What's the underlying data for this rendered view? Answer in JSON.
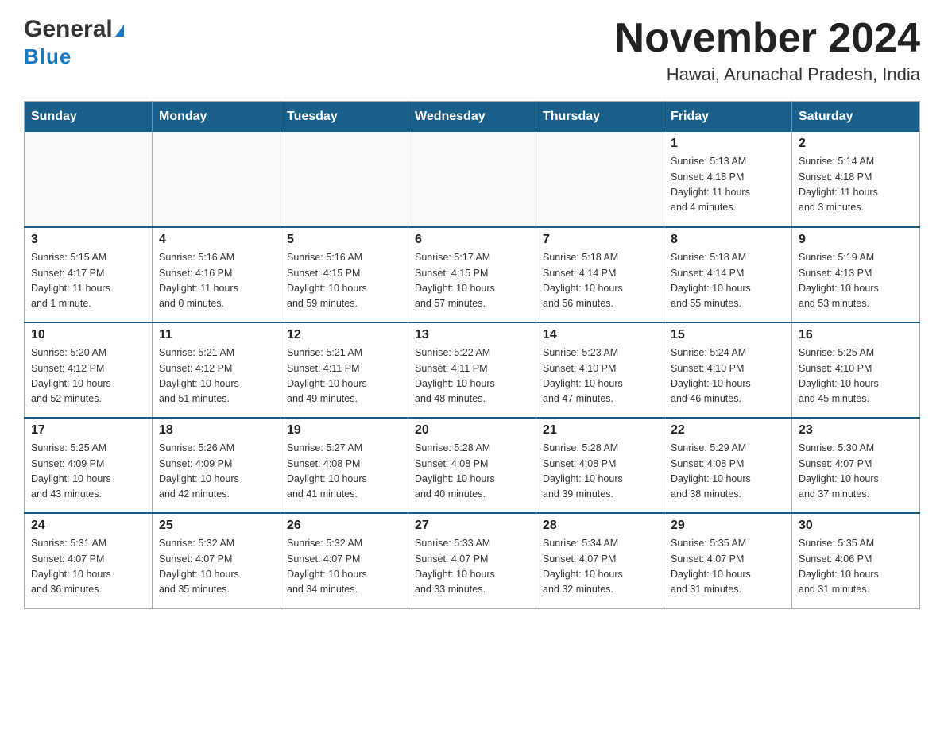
{
  "header": {
    "logo_general": "General",
    "logo_blue": "Blue",
    "month_title": "November 2024",
    "location": "Hawai, Arunachal Pradesh, India"
  },
  "weekdays": [
    "Sunday",
    "Monday",
    "Tuesday",
    "Wednesday",
    "Thursday",
    "Friday",
    "Saturday"
  ],
  "weeks": [
    [
      {
        "day": "",
        "info": ""
      },
      {
        "day": "",
        "info": ""
      },
      {
        "day": "",
        "info": ""
      },
      {
        "day": "",
        "info": ""
      },
      {
        "day": "",
        "info": ""
      },
      {
        "day": "1",
        "info": "Sunrise: 5:13 AM\nSunset: 4:18 PM\nDaylight: 11 hours\nand 4 minutes."
      },
      {
        "day": "2",
        "info": "Sunrise: 5:14 AM\nSunset: 4:18 PM\nDaylight: 11 hours\nand 3 minutes."
      }
    ],
    [
      {
        "day": "3",
        "info": "Sunrise: 5:15 AM\nSunset: 4:17 PM\nDaylight: 11 hours\nand 1 minute."
      },
      {
        "day": "4",
        "info": "Sunrise: 5:16 AM\nSunset: 4:16 PM\nDaylight: 11 hours\nand 0 minutes."
      },
      {
        "day": "5",
        "info": "Sunrise: 5:16 AM\nSunset: 4:15 PM\nDaylight: 10 hours\nand 59 minutes."
      },
      {
        "day": "6",
        "info": "Sunrise: 5:17 AM\nSunset: 4:15 PM\nDaylight: 10 hours\nand 57 minutes."
      },
      {
        "day": "7",
        "info": "Sunrise: 5:18 AM\nSunset: 4:14 PM\nDaylight: 10 hours\nand 56 minutes."
      },
      {
        "day": "8",
        "info": "Sunrise: 5:18 AM\nSunset: 4:14 PM\nDaylight: 10 hours\nand 55 minutes."
      },
      {
        "day": "9",
        "info": "Sunrise: 5:19 AM\nSunset: 4:13 PM\nDaylight: 10 hours\nand 53 minutes."
      }
    ],
    [
      {
        "day": "10",
        "info": "Sunrise: 5:20 AM\nSunset: 4:12 PM\nDaylight: 10 hours\nand 52 minutes."
      },
      {
        "day": "11",
        "info": "Sunrise: 5:21 AM\nSunset: 4:12 PM\nDaylight: 10 hours\nand 51 minutes."
      },
      {
        "day": "12",
        "info": "Sunrise: 5:21 AM\nSunset: 4:11 PM\nDaylight: 10 hours\nand 49 minutes."
      },
      {
        "day": "13",
        "info": "Sunrise: 5:22 AM\nSunset: 4:11 PM\nDaylight: 10 hours\nand 48 minutes."
      },
      {
        "day": "14",
        "info": "Sunrise: 5:23 AM\nSunset: 4:10 PM\nDaylight: 10 hours\nand 47 minutes."
      },
      {
        "day": "15",
        "info": "Sunrise: 5:24 AM\nSunset: 4:10 PM\nDaylight: 10 hours\nand 46 minutes."
      },
      {
        "day": "16",
        "info": "Sunrise: 5:25 AM\nSunset: 4:10 PM\nDaylight: 10 hours\nand 45 minutes."
      }
    ],
    [
      {
        "day": "17",
        "info": "Sunrise: 5:25 AM\nSunset: 4:09 PM\nDaylight: 10 hours\nand 43 minutes."
      },
      {
        "day": "18",
        "info": "Sunrise: 5:26 AM\nSunset: 4:09 PM\nDaylight: 10 hours\nand 42 minutes."
      },
      {
        "day": "19",
        "info": "Sunrise: 5:27 AM\nSunset: 4:08 PM\nDaylight: 10 hours\nand 41 minutes."
      },
      {
        "day": "20",
        "info": "Sunrise: 5:28 AM\nSunset: 4:08 PM\nDaylight: 10 hours\nand 40 minutes."
      },
      {
        "day": "21",
        "info": "Sunrise: 5:28 AM\nSunset: 4:08 PM\nDaylight: 10 hours\nand 39 minutes."
      },
      {
        "day": "22",
        "info": "Sunrise: 5:29 AM\nSunset: 4:08 PM\nDaylight: 10 hours\nand 38 minutes."
      },
      {
        "day": "23",
        "info": "Sunrise: 5:30 AM\nSunset: 4:07 PM\nDaylight: 10 hours\nand 37 minutes."
      }
    ],
    [
      {
        "day": "24",
        "info": "Sunrise: 5:31 AM\nSunset: 4:07 PM\nDaylight: 10 hours\nand 36 minutes."
      },
      {
        "day": "25",
        "info": "Sunrise: 5:32 AM\nSunset: 4:07 PM\nDaylight: 10 hours\nand 35 minutes."
      },
      {
        "day": "26",
        "info": "Sunrise: 5:32 AM\nSunset: 4:07 PM\nDaylight: 10 hours\nand 34 minutes."
      },
      {
        "day": "27",
        "info": "Sunrise: 5:33 AM\nSunset: 4:07 PM\nDaylight: 10 hours\nand 33 minutes."
      },
      {
        "day": "28",
        "info": "Sunrise: 5:34 AM\nSunset: 4:07 PM\nDaylight: 10 hours\nand 32 minutes."
      },
      {
        "day": "29",
        "info": "Sunrise: 5:35 AM\nSunset: 4:07 PM\nDaylight: 10 hours\nand 31 minutes."
      },
      {
        "day": "30",
        "info": "Sunrise: 5:35 AM\nSunset: 4:06 PM\nDaylight: 10 hours\nand 31 minutes."
      }
    ]
  ]
}
